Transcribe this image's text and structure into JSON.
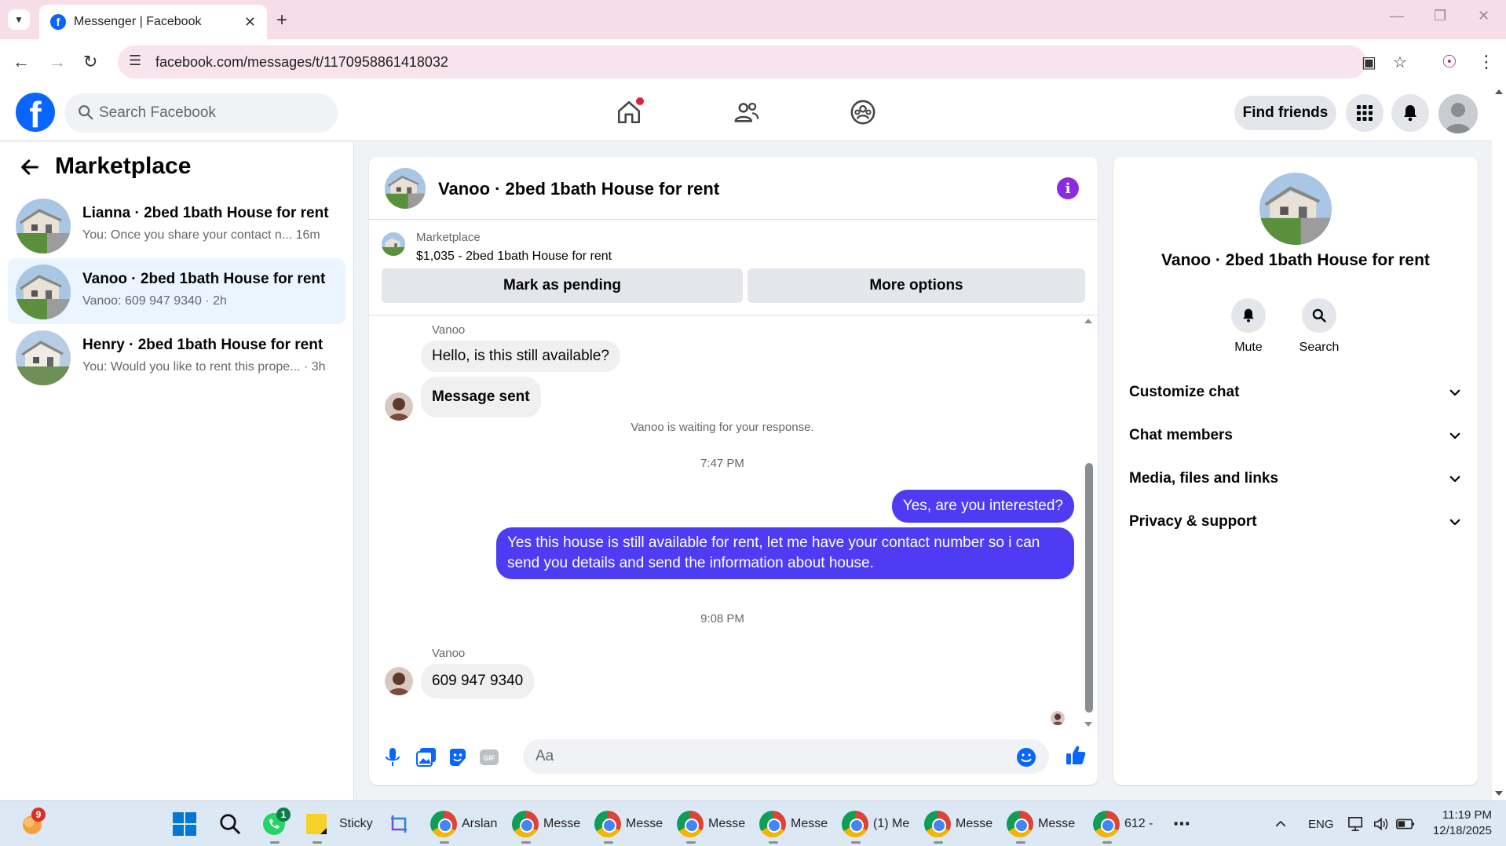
{
  "browser": {
    "tab_title": "Messenger | Facebook",
    "url": "facebook.com/messages/t/1170958861418032"
  },
  "fb": {
    "search_placeholder": "Search Facebook",
    "find_friends": "Find friends"
  },
  "sidebar": {
    "title": "Marketplace",
    "conversations": [
      {
        "name": "Lianna · 2bed 1bath House for rent",
        "preview": "You: Once you share your contact n...  16m"
      },
      {
        "name": "Vanoo · 2bed 1bath House for rent",
        "preview": "Vanoo: 609 947 9340 · 2h"
      },
      {
        "name": "Henry · 2bed 1bath House for rent",
        "preview": "You: Would you like to rent this prope... · 3h"
      }
    ]
  },
  "chat": {
    "title": "Vanoo · 2bed 1bath House for rent",
    "marketplace_label": "Marketplace",
    "listing": "$1,035 - 2bed 1bath House for rent",
    "mark_pending": "Mark as pending",
    "more_options": "More options",
    "messages": {
      "sender1": "Vanoo",
      "in1": "Hello, is this still available?",
      "in2": "Message sent",
      "waiting": "Vanoo is waiting for your response.",
      "time1": "7:47 PM",
      "out1": "Yes, are you interested?",
      "out2": "Yes this house is still available for rent, let me have your contact number so i can send you details and send the information about house.",
      "time2": "9:08 PM",
      "sender2": "Vanoo",
      "in3": "609 947 9340"
    },
    "composer_placeholder": "Aa"
  },
  "details": {
    "title": "Vanoo · 2bed 1bath House for rent",
    "mute": "Mute",
    "search": "Search",
    "rows": [
      "Customize chat",
      "Chat members",
      "Media, files and links",
      "Privacy & support"
    ]
  },
  "taskbar": {
    "weather_badge": "9",
    "whatsapp_badge": "1",
    "sticky": "Sticky",
    "apps": [
      "Arslan",
      "Messe",
      "Messe",
      "Messe",
      "Messe",
      "(1) Me",
      "Messe",
      "Messe",
      "612 -"
    ],
    "lang": "ENG",
    "time": "11:19 PM",
    "date": "12/18/2025"
  },
  "colors": {
    "fb_blue": "#0866ff",
    "outgoing_bubble": "#4e3cf5",
    "active_conversation": "#ebf5ff"
  }
}
